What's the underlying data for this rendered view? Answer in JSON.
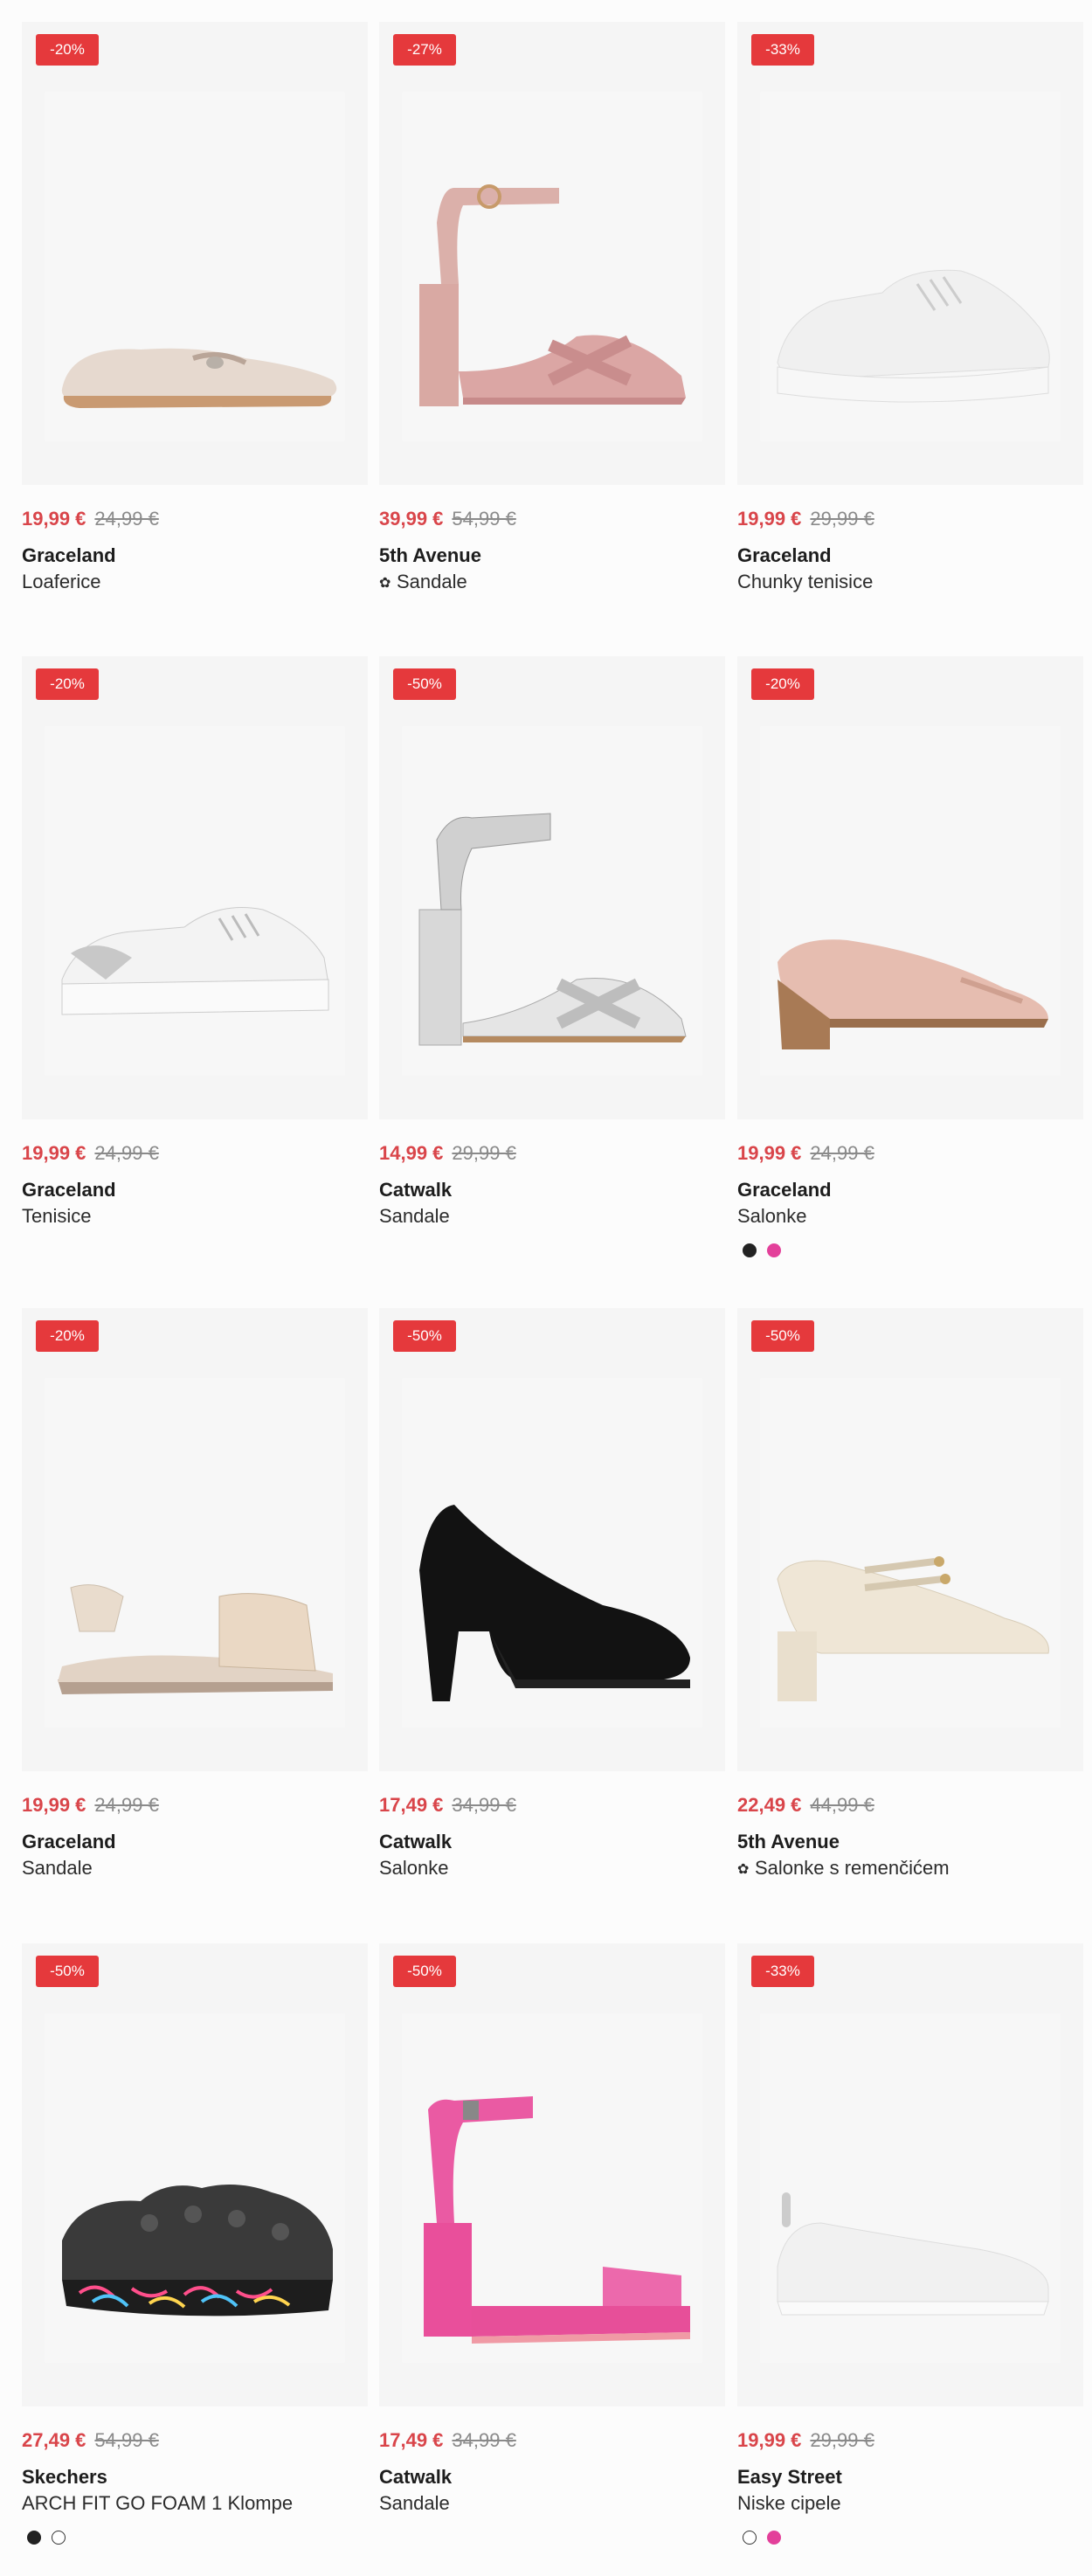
{
  "products": [
    {
      "discount": "-20%",
      "price": "19,99 €",
      "old_price": "24,99 €",
      "brand": "Graceland",
      "type": "Loaferice",
      "eco": false,
      "swatches": []
    },
    {
      "discount": "-27%",
      "price": "39,99 €",
      "old_price": "54,99 €",
      "brand": "5th Avenue",
      "type": "Sandale",
      "eco": true,
      "swatches": []
    },
    {
      "discount": "-33%",
      "price": "19,99 €",
      "old_price": "29,99 €",
      "brand": "Graceland",
      "type": "Chunky tenisice",
      "eco": false,
      "swatches": []
    },
    {
      "discount": "-20%",
      "price": "19,99 €",
      "old_price": "24,99 €",
      "brand": "Graceland",
      "type": "Tenisice",
      "eco": false,
      "swatches": []
    },
    {
      "discount": "-50%",
      "price": "14,99 €",
      "old_price": "29,99 €",
      "brand": "Catwalk",
      "type": "Sandale",
      "eco": false,
      "swatches": []
    },
    {
      "discount": "-20%",
      "price": "19,99 €",
      "old_price": "24,99 €",
      "brand": "Graceland",
      "type": "Salonke",
      "eco": false,
      "swatches": [
        "black",
        "pink"
      ]
    },
    {
      "discount": "-20%",
      "price": "19,99 €",
      "old_price": "24,99 €",
      "brand": "Graceland",
      "type": "Sandale",
      "eco": false,
      "swatches": []
    },
    {
      "discount": "-50%",
      "price": "17,49 €",
      "old_price": "34,99 €",
      "brand": "Catwalk",
      "type": "Salonke",
      "eco": false,
      "swatches": []
    },
    {
      "discount": "-50%",
      "price": "22,49 €",
      "old_price": "44,99 €",
      "brand": "5th Avenue",
      "type": "Salonke s remenčićem",
      "eco": true,
      "swatches": []
    },
    {
      "discount": "-50%",
      "price": "27,49 €",
      "old_price": "54,99 €",
      "brand": "Skechers",
      "type": "ARCH FIT GO FOAM 1 Klompe",
      "eco": false,
      "swatches": [
        "black",
        "white"
      ]
    },
    {
      "discount": "-50%",
      "price": "17,49 €",
      "old_price": "34,99 €",
      "brand": "Catwalk",
      "type": "Sandale",
      "eco": false,
      "swatches": []
    },
    {
      "discount": "-33%",
      "price": "19,99 €",
      "old_price": "29,99 €",
      "brand": "Easy Street",
      "type": "Niske cipele",
      "eco": false,
      "swatches": [
        "white",
        "pink"
      ]
    }
  ],
  "eco_icon": "leaf-icon",
  "colors": {
    "badge": "#e5393c",
    "price": "#d9454a",
    "old_price": "#8a8a8a"
  }
}
